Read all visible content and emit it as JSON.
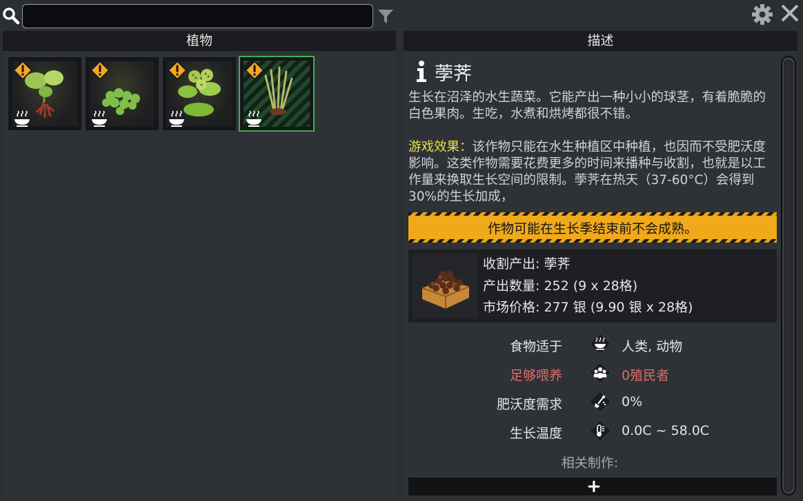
{
  "search": {
    "value": "",
    "placeholder": ""
  },
  "icons": {
    "search": "search-icon",
    "filter": "filter-icon",
    "settings": "gear-icon",
    "close": "close-icon",
    "warning": "warning-icon",
    "food": "bowl-icon",
    "info": "info-icon"
  },
  "colors": {
    "selected_border": "#3fb24a",
    "warning_yellow": "#f0a91b",
    "effect_label": "#e8e44a",
    "alert_red": "#e06a6a"
  },
  "left_panel": {
    "header": "植物",
    "plants": [
      {
        "selected": false
      },
      {
        "selected": false
      },
      {
        "selected": false
      },
      {
        "selected": true
      }
    ]
  },
  "right_panel": {
    "header": "描述",
    "title": "荸荠",
    "description": "生长在沼泽的水生蔬菜。它能产出一种小小的球茎，有着脆脆的白色果肉。生吃，水煮和烘烤都很不错。",
    "effect_label": "游戏效果：",
    "effect_text": "该作物只能在水生种植区中种植，也因而不受肥沃度影响。这类作物需要花费更多的时间来播种与收割，也就是以工作量来换取生长空间的限制。荸荠在热天（37-60°C）会得到30%的生长加成，",
    "warning": "作物可能在生长季结束前不会成熟。",
    "harvest": {
      "output": "收割产出: 荸荠",
      "quantity": "产出数量: 252 (9 x 28格)",
      "price": "市场价格: 277 银 (9.90 银 x 28格)"
    },
    "stats": [
      {
        "label": "食物适于",
        "icon": "bowl-icon",
        "value": "人类, 动物",
        "alert": false
      },
      {
        "label": "足够喂养",
        "icon": "colonist-group-icon",
        "value": "0殖民者",
        "alert": true
      },
      {
        "label": "肥沃度需求",
        "icon": "fertilizer-shovel-icon",
        "value": "0%",
        "alert": false
      },
      {
        "label": "生长温度",
        "icon": "thermometer-icon",
        "value": "0.0C ~ 58.0C",
        "alert": false
      }
    ],
    "related_label": "相关制作:",
    "add_label": "+"
  }
}
